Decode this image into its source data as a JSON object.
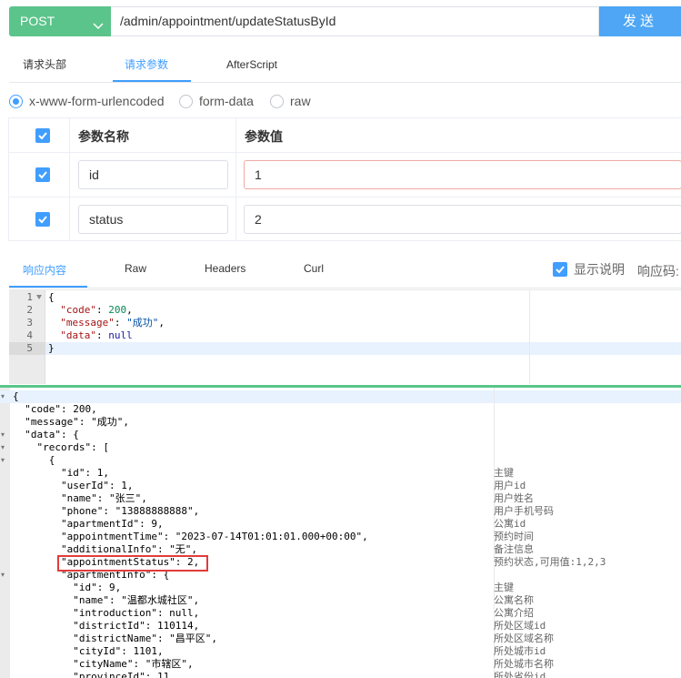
{
  "request": {
    "method": "POST",
    "url": "/admin/appointment/updateStatusById",
    "send_label": "发送"
  },
  "tabs": [
    "请求头部",
    "请求参数",
    "AfterScript"
  ],
  "active_tab": "请求参数",
  "body_types": [
    "x-www-form-urlencoded",
    "form-data",
    "raw"
  ],
  "selected_body_type": "x-www-form-urlencoded",
  "params": {
    "headers": [
      "参数名称",
      "参数值"
    ],
    "rows": [
      {
        "name": "id",
        "value": "1",
        "checked": true
      },
      {
        "name": "status",
        "value": "2",
        "checked": true
      }
    ]
  },
  "response_tabs": [
    "响应内容",
    "Raw",
    "Headers",
    "Curl"
  ],
  "active_response_tab": "响应内容",
  "show_desc_label": "显示说明",
  "response_code_label": "响应码:",
  "editor": {
    "line_numbers": [
      "1",
      "2",
      "3",
      "4",
      "5"
    ],
    "lines": [
      "{",
      "  \"code\": 200,",
      "  \"message\": \"成功\",",
      "  \"data\": null",
      "}"
    ]
  },
  "viewer": {
    "lines": [
      "{",
      "  \"code\": 200,",
      "  \"message\": \"成功\",",
      "  \"data\": {",
      "    \"records\": [",
      "      {",
      "        \"id\": 1,",
      "        \"userId\": 1,",
      "        \"name\": \"张三\",",
      "        \"phone\": \"13888888888\",",
      "        \"apartmentId\": 9,",
      "        \"appointmentTime\": \"2023-07-14T01:01:01.000+00:00\",",
      "        \"additionalInfo\": \"无\",",
      "        \"appointmentStatus\": 2,",
      "        \"apartmentInfo\": {",
      "          \"id\": 9,",
      "          \"name\": \"温都水城社区\",",
      "          \"introduction\": null,",
      "          \"districtId\": 110114,",
      "          \"districtName\": \"昌平区\",",
      "          \"cityId\": 1101,",
      "          \"cityName\": \"市辖区\",",
      "          \"provinceId\": 11,"
    ],
    "descriptions": [
      "",
      "",
      "",
      "",
      "",
      "",
      "主键",
      "用户id",
      "用户姓名",
      "用户手机号码",
      "公寓id",
      "预约时间",
      "备注信息",
      "预约状态,可用值:1,2,3",
      "",
      "主键",
      "公寓名称",
      "公寓介绍",
      "所处区域id",
      "所处区域名称",
      "所处城市id",
      "所处城市名称",
      "所处省份id"
    ],
    "folds": [
      "▾",
      "",
      "",
      "▾",
      "▾",
      "▾",
      "",
      "",
      "",
      "",
      "",
      "",
      "",
      "",
      "▾",
      "",
      "",
      "",
      "",
      "",
      "",
      "",
      ""
    ]
  }
}
